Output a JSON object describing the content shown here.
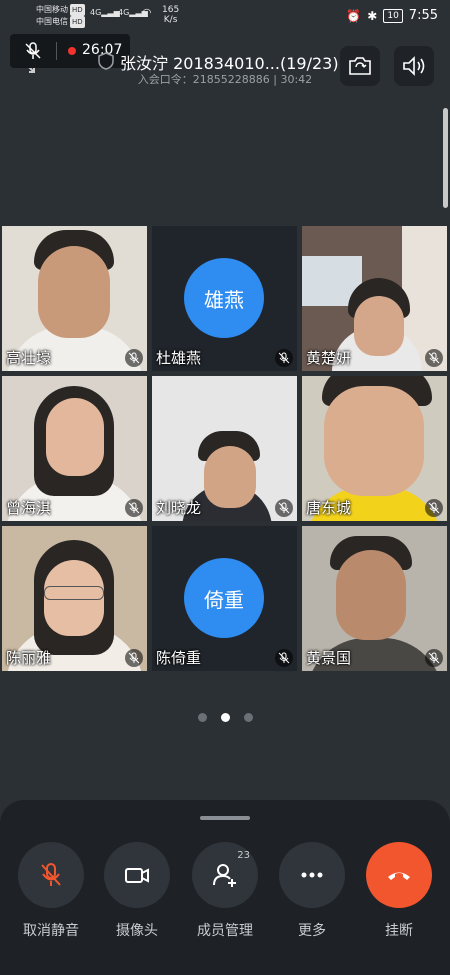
{
  "status_bar": {
    "carrier1": "中国移动",
    "carrier2": "中国电信",
    "hd_badge": "HD",
    "net1": "4G",
    "net2": "4G",
    "speed_value": "165",
    "speed_unit": "K/s",
    "battery": "10",
    "time": "7:55"
  },
  "top": {
    "record_time": "26:07",
    "title": "张汝泞 201834010...(19/23)",
    "meeting_code": "入会口令：21855228886 | 30:42"
  },
  "participants": [
    {
      "name": "高壮壕",
      "avatar_text": "",
      "video": true
    },
    {
      "name": "杜雄燕",
      "avatar_text": "雄燕",
      "video": false
    },
    {
      "name": "黄楚妍",
      "avatar_text": "",
      "video": true
    },
    {
      "name": "曾海淇",
      "avatar_text": "",
      "video": true
    },
    {
      "name": "刘晓龙",
      "avatar_text": "",
      "video": true
    },
    {
      "name": "唐东城",
      "avatar_text": "",
      "video": true
    },
    {
      "name": "陈丽雅",
      "avatar_text": "",
      "video": true
    },
    {
      "name": "陈倚重",
      "avatar_text": "倚重",
      "video": false
    },
    {
      "name": "黄景国",
      "avatar_text": "",
      "video": true
    }
  ],
  "pagination": {
    "pages": 3,
    "active": 1
  },
  "controls": {
    "unmute_label": "取消静音",
    "camera_label": "摄像头",
    "members_label": "成员管理",
    "members_count": "23",
    "more_label": "更多",
    "hangup_label": "挂断"
  },
  "colors": {
    "background": "#2b3035",
    "accent_blue": "#2f8cf0",
    "hangup": "#f2562e",
    "record": "#f0332c",
    "mute_icon": "#f2562e"
  }
}
